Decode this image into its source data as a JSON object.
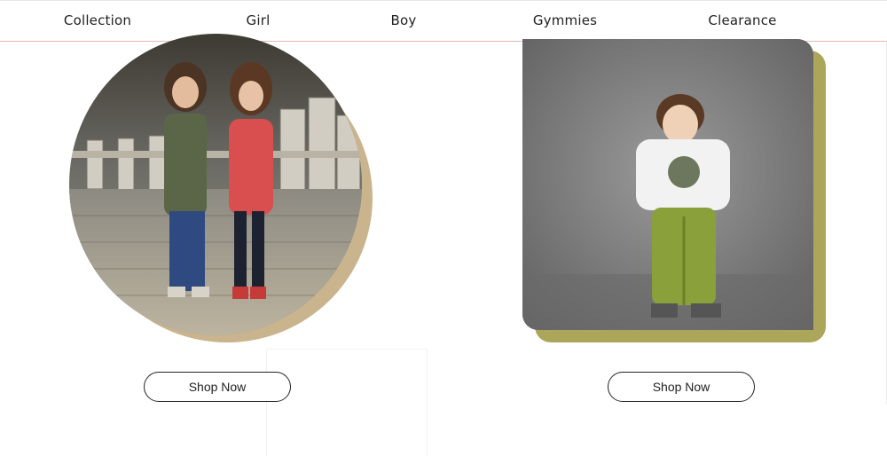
{
  "nav": {
    "items": [
      {
        "label": "Collection"
      },
      {
        "label": "Girl"
      },
      {
        "label": "Boy"
      },
      {
        "label": "Gymmies"
      },
      {
        "label": "Clearance"
      }
    ]
  },
  "left_card": {
    "button_label": "Shop Now"
  },
  "right_card": {
    "button_label": "Shop Now"
  },
  "colors": {
    "nav_border": "#e8b9b3",
    "circle_backdrop": "#c9b48d",
    "rect_backdrop": "#aba65a"
  }
}
